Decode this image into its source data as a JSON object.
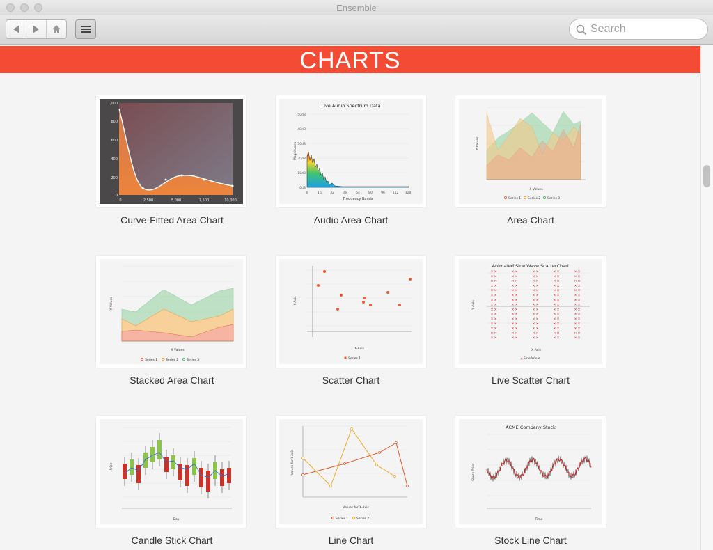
{
  "window": {
    "title": "Ensemble"
  },
  "toolbar": {
    "search_placeholder": "Search"
  },
  "banner": {
    "title": "CHARTS"
  },
  "samples": [
    {
      "caption": "Curve-Fitted Area Chart"
    },
    {
      "caption": "Audio Area Chart"
    },
    {
      "caption": "Area Chart"
    },
    {
      "caption": "Stacked Area Chart"
    },
    {
      "caption": "Scatter Chart"
    },
    {
      "caption": "Live Scatter Chart"
    },
    {
      "caption": "Candle Stick Chart"
    },
    {
      "caption": "Line Chart"
    },
    {
      "caption": "Stock Line Chart"
    }
  ],
  "thumbs": {
    "curve": {
      "y_ticks": [
        "1,000",
        "800",
        "600",
        "400",
        "200",
        "0"
      ],
      "x_ticks": [
        "0",
        "2,500",
        "5,000",
        "7,500",
        "10,000"
      ]
    },
    "audio": {
      "title": "Live Audio Spectrum Data",
      "ylabel": "Magnitudes",
      "xlabel": "Frequency Bands",
      "y_ticks": [
        "50dB",
        "40dB",
        "30dB",
        "20dB",
        "10dB",
        "0dB"
      ],
      "x_ticks": [
        "0",
        "16",
        "32",
        "48",
        "64",
        "80",
        "96",
        "112",
        "128"
      ]
    },
    "area": {
      "ylabel": "Y Values",
      "xlabel": "X Values",
      "legend": [
        "Series 1",
        "Series 2",
        "Series 3"
      ]
    },
    "stacked": {
      "ylabel": "Y Values",
      "xlabel": "X Values",
      "legend": [
        "Series 1",
        "Series 2",
        "Series 3"
      ]
    },
    "scatter": {
      "ylabel": "Y-Axis",
      "xlabel": "X-Axis",
      "legend": "Series 1"
    },
    "live": {
      "title": "Animated Sine Wave ScatterChart",
      "ylabel": "Y Axis",
      "xlabel": "X Axis",
      "legend": "Sine Wave"
    },
    "candle": {
      "ylabel": "Price",
      "xlabel": "Day"
    },
    "line": {
      "ylabel": "Values for Y-Axis",
      "xlabel": "Values for X-Axis",
      "legend": [
        "Series 1",
        "Series 2"
      ]
    },
    "stock": {
      "title": "ACME Company Stock",
      "ylabel": "Share Price",
      "xlabel": "Time"
    }
  }
}
